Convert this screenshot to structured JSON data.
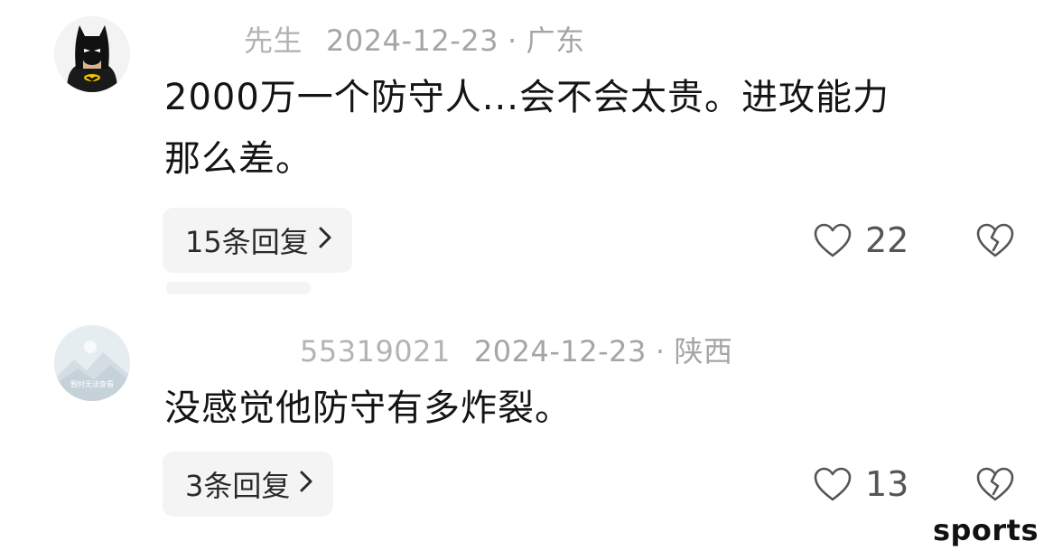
{
  "comments": [
    {
      "username": "先生",
      "date": "2024-12-23",
      "location": "广东",
      "text_line1": "2000万一个防守人...会不会太贵。进攻能力",
      "text_line2": "那么差。",
      "replies_label": "15条回复",
      "likes": "22",
      "avatar_icon": "batman-avatar-icon"
    },
    {
      "username": "55319021",
      "date": "2024-12-23",
      "location": "陕西",
      "text_line1": "没感觉他防守有多炸裂。",
      "replies_label": "3条回复",
      "likes": "13",
      "avatar_icon": "placeholder-image-icon",
      "avatar_caption": "暂时无法查看"
    }
  ],
  "watermark": "sports",
  "colors": {
    "meta_text": "#a5a5a5",
    "body_text": "#141414",
    "reply_bg": "#f4f4f4",
    "icon": "#555555"
  }
}
